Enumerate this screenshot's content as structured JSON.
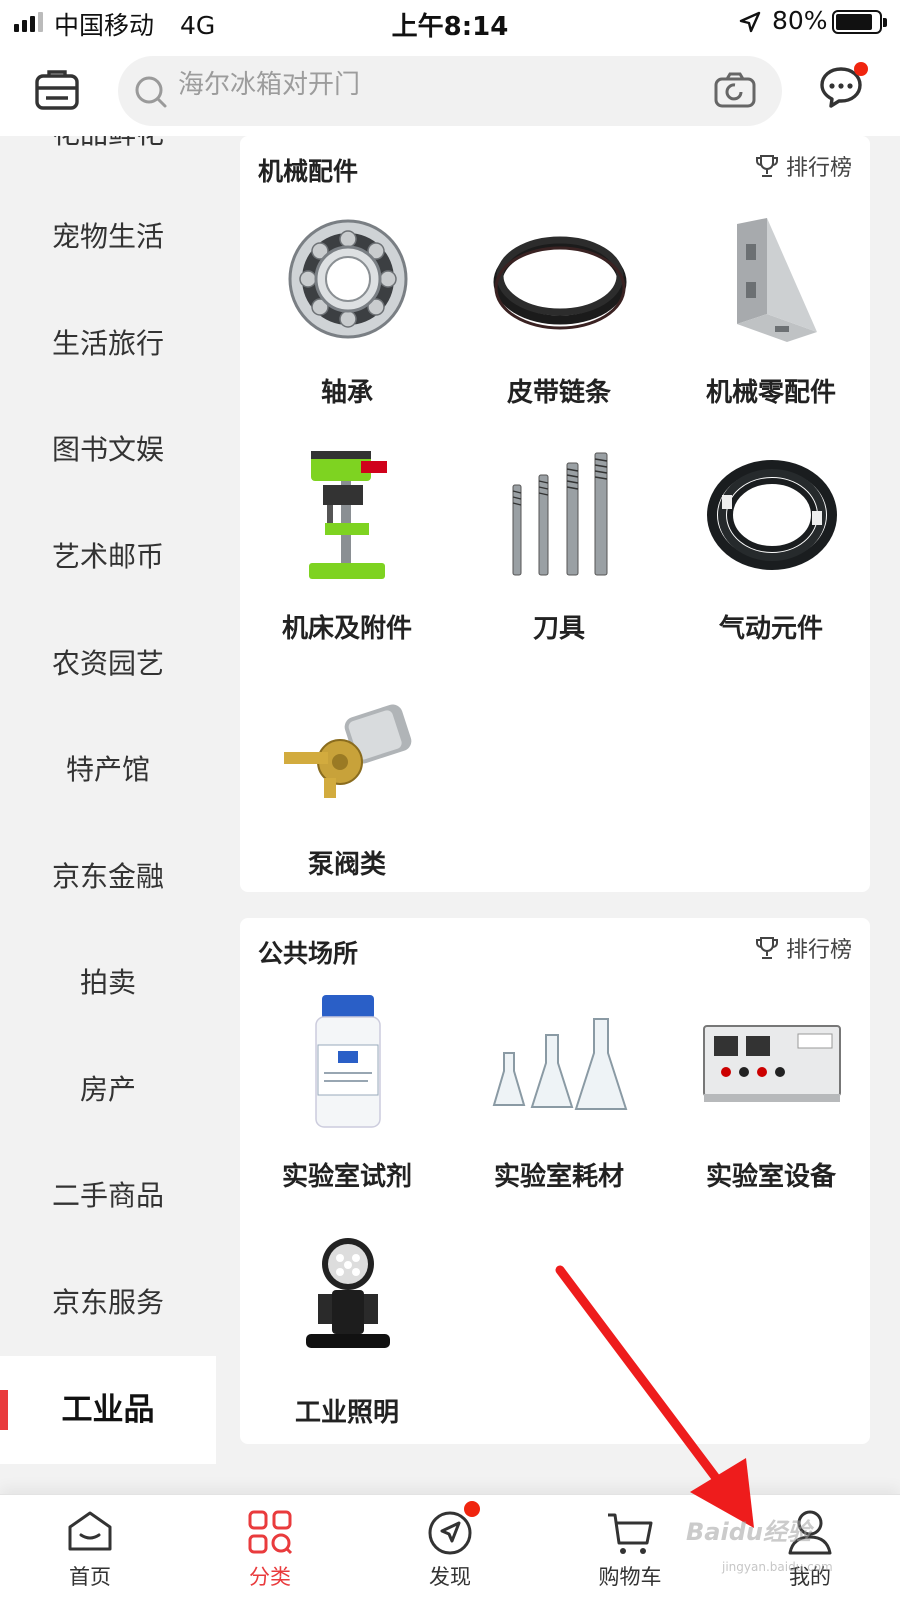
{
  "status_bar": {
    "carrier": "中国移动",
    "network": "4G",
    "time": "上午8:14",
    "battery": "80%"
  },
  "header": {
    "search_placeholder": "海尔冰箱对开门"
  },
  "sidebar": {
    "partial_top": "花品鲜花",
    "items": [
      "宠物生活",
      "生活旅行",
      "图书文娱",
      "艺术邮币",
      "农资园艺",
      "特产馆",
      "京东金融",
      "拍卖",
      "房产",
      "二手商品",
      "京东服务"
    ],
    "active": "工业品"
  },
  "sections": [
    {
      "title": "机械配件",
      "rank_label": "排行榜",
      "items": [
        {
          "name": "轴承",
          "icon": "bearing-image"
        },
        {
          "name": "皮带链条",
          "icon": "belt-image"
        },
        {
          "name": "机械零配件",
          "icon": "bracket-image"
        },
        {
          "name": "机床及附件",
          "icon": "drill-press-image"
        },
        {
          "name": "刀具",
          "icon": "taps-image"
        },
        {
          "name": "气动元件",
          "icon": "air-hose-image"
        },
        {
          "name": "泵阀类",
          "icon": "pump-image"
        }
      ]
    },
    {
      "title": "公共场所",
      "rank_label": "排行榜",
      "items": [
        {
          "name": "实验室试剂",
          "icon": "reagent-bottle-image"
        },
        {
          "name": "实验室耗材",
          "icon": "flasks-image"
        },
        {
          "name": "实验室设备",
          "icon": "lab-device-image"
        },
        {
          "name": "工业照明",
          "icon": "searchlight-image"
        }
      ]
    }
  ],
  "bottom_nav": [
    {
      "label": "首页",
      "icon": "home-icon"
    },
    {
      "label": "分类",
      "icon": "category-icon",
      "active": true
    },
    {
      "label": "发现",
      "icon": "discover-icon"
    },
    {
      "label": "购物车",
      "icon": "cart-icon"
    },
    {
      "label": "我的",
      "icon": "profile-icon"
    }
  ],
  "watermark": {
    "text": "Baidu经验",
    "sub": "jingyan.baidu.com"
  },
  "colors": {
    "accent": "#e93b3d",
    "badge": "#f0250f",
    "annotation_arrow": "#ee1c1c"
  }
}
